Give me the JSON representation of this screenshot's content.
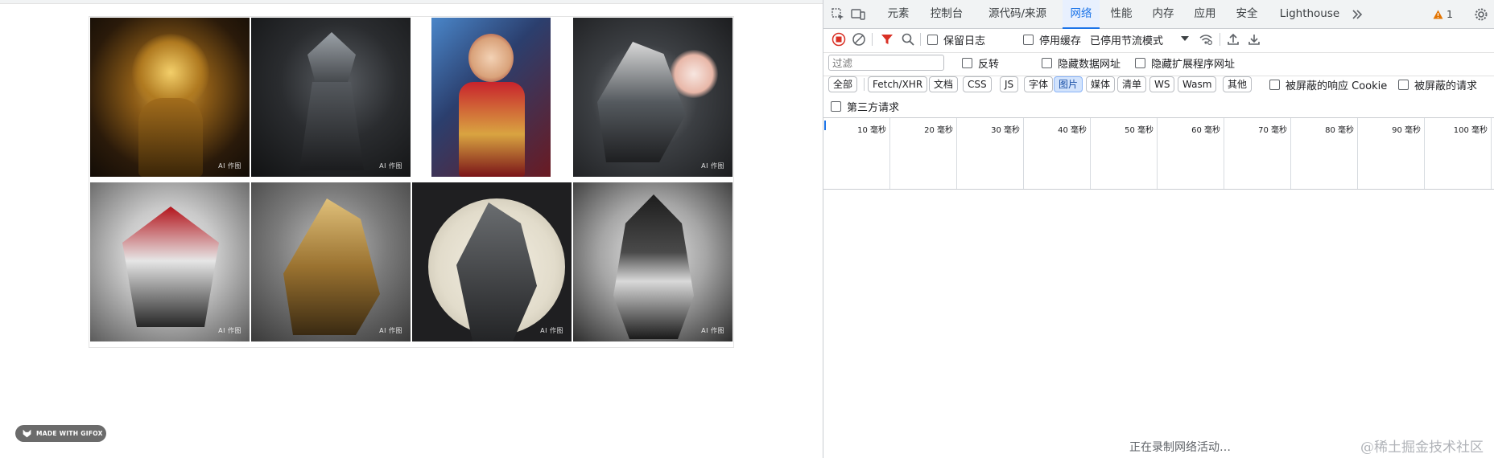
{
  "page": {
    "gallery_badge": "AI 作图",
    "gifox_label": "MADE WITH GIFOX"
  },
  "devtools": {
    "tabs": [
      "元素",
      "控制台",
      "源代码/来源",
      "网络",
      "性能",
      "内存",
      "应用",
      "安全",
      "Lighthouse"
    ],
    "active_tab": "网络",
    "warning_count": "1",
    "toolbar": {
      "preserve_log": "保留日志",
      "disable_cache": "停用缓存",
      "throttling": "已停用节流模式"
    },
    "filter": {
      "placeholder": "过滤",
      "invert": "反转",
      "hide_data_urls": "隐藏数据网址",
      "hide_extension_urls": "隐藏扩展程序网址"
    },
    "type_filters": [
      "全部",
      "Fetch/XHR",
      "文档",
      "CSS",
      "JS",
      "字体",
      "图片",
      "媒体",
      "清单",
      "WS",
      "Wasm",
      "其他"
    ],
    "active_type_filter": "图片",
    "blocked_cookies": "被屏蔽的响应 Cookie",
    "blocked_requests": "被屏蔽的请求",
    "third_party": "第三方请求",
    "timeline_ticks": [
      "10 毫秒",
      "20 毫秒",
      "30 毫秒",
      "40 毫秒",
      "50 毫秒",
      "60 毫秒",
      "70 毫秒",
      "80 毫秒",
      "90 毫秒",
      "100 毫秒"
    ],
    "status": "正在录制网络活动…"
  },
  "watermark": "@稀土掘金技术社区",
  "colors": {
    "accent": "#1a73e8",
    "record_red": "#d93025",
    "filter_red": "#d93025"
  }
}
